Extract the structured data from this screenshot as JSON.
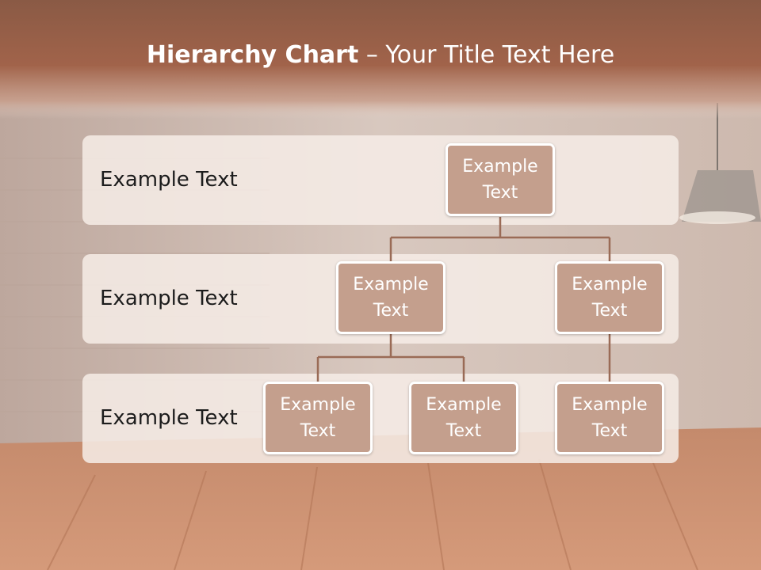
{
  "slide": {
    "title_bold": "Hierarchy Chart",
    "title_rest": " – Your Title Text Here"
  },
  "levels": [
    {
      "label": "Example Text"
    },
    {
      "label": "Example Text"
    },
    {
      "label": "Example Text"
    }
  ],
  "nodes": [
    {
      "id": "root",
      "text": "Example Text"
    },
    {
      "id": "mid-left",
      "text": "Example Text"
    },
    {
      "id": "mid-right",
      "text": "Example Text"
    },
    {
      "id": "leaf-1",
      "text": "Example Text"
    },
    {
      "id": "leaf-2",
      "text": "Example Text"
    },
    {
      "id": "leaf-3",
      "text": "Example Text"
    }
  ],
  "colors": {
    "header": "#9b5c43",
    "node_fill": "#c49f8d",
    "connector": "#9a6b56",
    "band": "#f6ece7"
  }
}
